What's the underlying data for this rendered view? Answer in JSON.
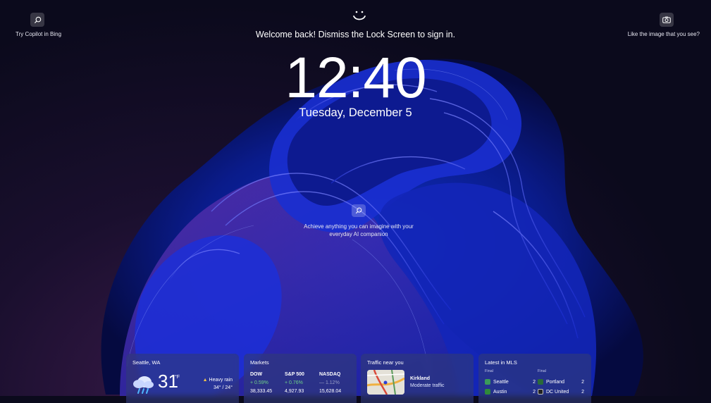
{
  "top": {
    "copilot_label": "Try Copilot in Bing",
    "image_label": "Like the image that you see?",
    "welcome": "Welcome back! Dismiss the Lock Screen to sign in."
  },
  "clock": {
    "time": "12:40",
    "date": "Tuesday, December 5"
  },
  "center": {
    "tagline": "Achieve anything you can imagine with your everyday AI companion"
  },
  "widgets": {
    "weather": {
      "title": "Seattle, WA",
      "temp": "31",
      "unit": "°F",
      "condition": "Heavy rain",
      "hilo": "34° /  24°",
      "warn_icon": "▲"
    },
    "markets": {
      "title": "Markets",
      "items": [
        {
          "name": "DOW",
          "change": "+ 0.59%",
          "value": "38,333.45",
          "dir": "up"
        },
        {
          "name": "S&P 500",
          "change": "+ 0.76%",
          "value": "4,927.93",
          "dir": "up"
        },
        {
          "name": "NASDAQ",
          "change": "— 1.12%",
          "value": "15,628.04",
          "dir": "down"
        }
      ]
    },
    "traffic": {
      "title": "Traffic near you",
      "place": "Kirkland",
      "status": "Moderate traffic"
    },
    "mls": {
      "title": "Latest in MLS",
      "games": [
        {
          "status": "Final",
          "team1": "Seattle",
          "score1": "2",
          "team2": "Austin",
          "score2": "2"
        },
        {
          "status": "Final",
          "team1": "Portland",
          "score1": "2",
          "team2": "DC United",
          "score2": "2"
        }
      ]
    }
  },
  "colors": {
    "accent": "#2b3fd6",
    "widget_bg": "#303a78",
    "up": "#6fd48a"
  }
}
